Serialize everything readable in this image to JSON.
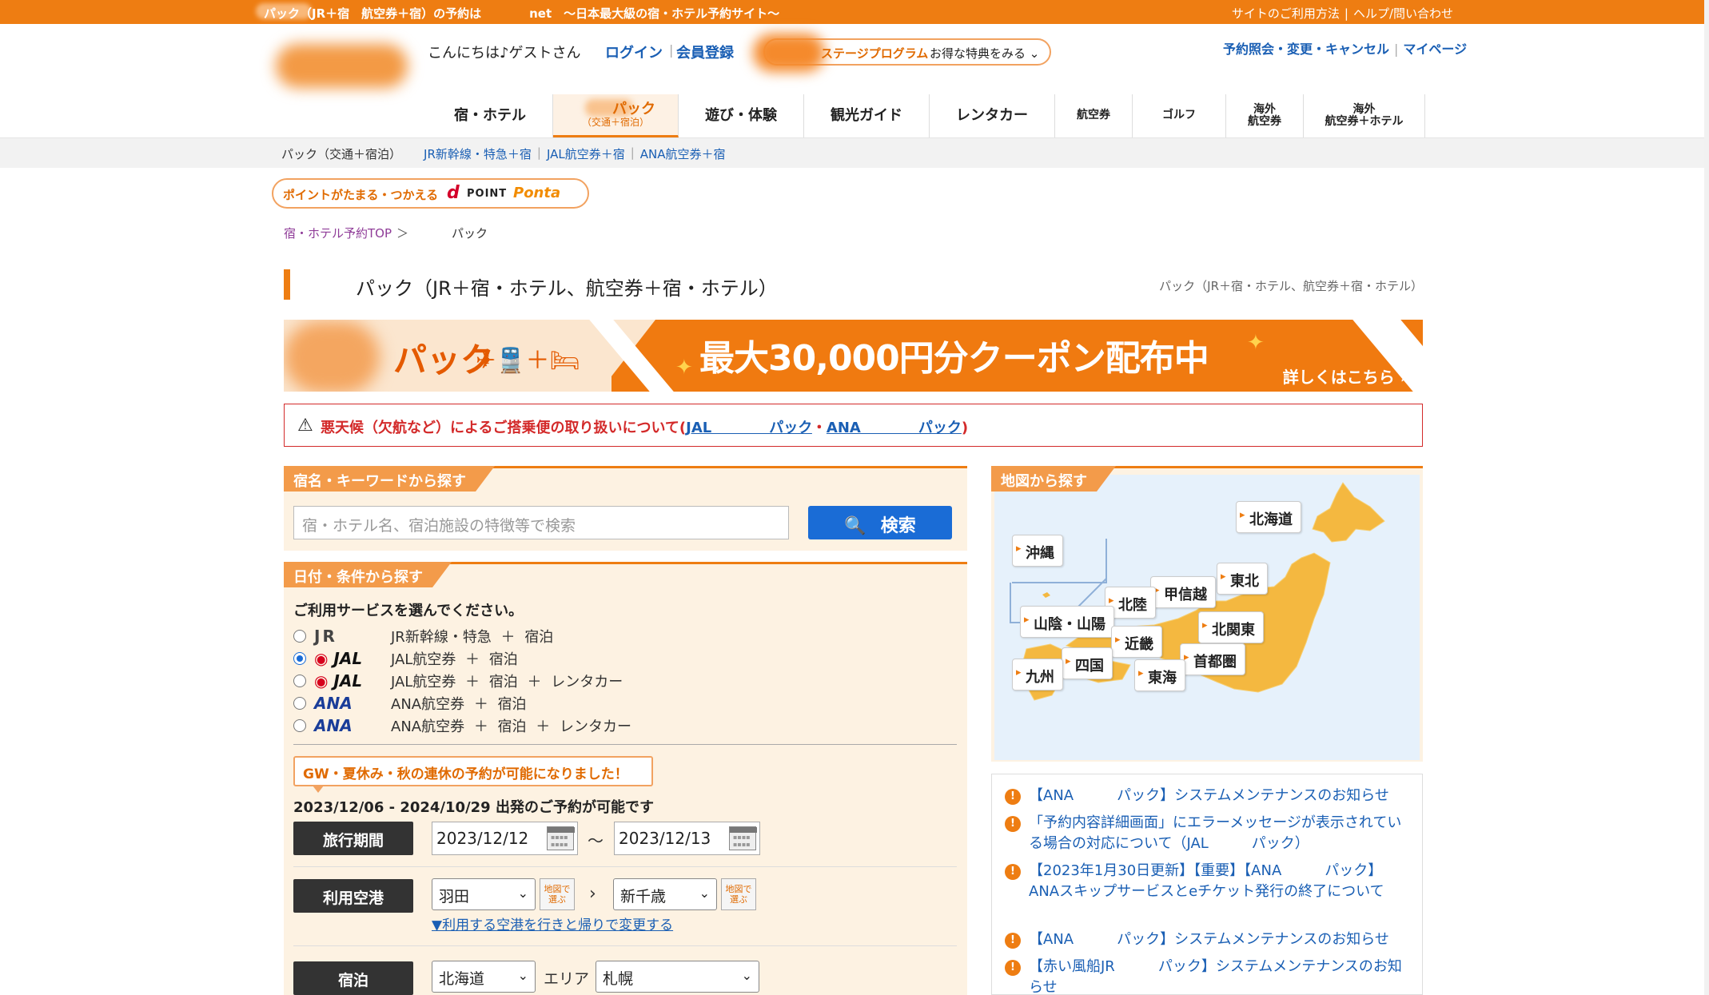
{
  "topbar": {
    "tagline": "パック（JR＋宿　航空券＋宿）の予約は　　　　net　〜日本最大級の宿・ホテル予約サイト〜",
    "links": [
      "サイトのご利用方法",
      "ヘルプ/問い合わせ"
    ]
  },
  "header": {
    "greeting": "こんにちは♪ゲストさん",
    "login": "ログイン",
    "register": "会員登録",
    "stage_program": "ステージプログラム",
    "stage_benefit": "お得な特典をみる",
    "my_links": [
      "予約照会・変更・キャンセル",
      "マイページ"
    ]
  },
  "nav": {
    "items": [
      {
        "label": "宿・ホテル"
      },
      {
        "label": "パック",
        "sub": "（交通＋宿泊）"
      },
      {
        "label": "遊び・体験"
      },
      {
        "label": "観光ガイド"
      },
      {
        "label": "レンタカー"
      },
      {
        "label": "航空券"
      },
      {
        "label": "ゴルフ"
      },
      {
        "label": "海外\n航空券"
      },
      {
        "label": "海外\n航空券＋ホテル"
      }
    ]
  },
  "subnav": {
    "current": "パック（交通＋宿泊）",
    "links": [
      "JR新幹線・特急＋宿",
      "JAL航空券＋宿",
      "ANA航空券＋宿"
    ]
  },
  "points": {
    "text": "ポイントがたまる・つかえる",
    "dpoint": "POINT",
    "ponta": "Ponta"
  },
  "breadcrumb": {
    "home": "宿・ホテル予約TOP",
    "current": "パック"
  },
  "page": {
    "title": "パック（JR＋宿・ホテル、航空券＋宿・ホテル）",
    "subtitle": "パック（JR＋宿・ホテル、航空券＋宿・ホテル）"
  },
  "promo": {
    "pack": "パック",
    "icons": "✈🚆＋🛏",
    "headline": "最大30,000円分クーポン配布中",
    "more": "詳しくはこちら ›"
  },
  "alert": {
    "text": "悪天候（欠航など）によるご搭乗便の取り扱いについて(",
    "link_jal": "JAL　　　　パック",
    "mid": "・",
    "link_ana": "ANA　　　　パック",
    "end": ")"
  },
  "keyword": {
    "tab": "宿名・キーワードから探す",
    "placeholder": "宿・ホテル名、宿泊施設の特徴等で検索",
    "button": "検索"
  },
  "conditions": {
    "tab": "日付・条件から探す",
    "question": "ご利用サービスを選んでください。",
    "services": [
      {
        "logo": "JR",
        "desc": "JR新幹線・特急 ＋ 宿泊",
        "selected": false
      },
      {
        "logo": "JAL",
        "desc": "JAL航空券 ＋ 宿泊",
        "selected": true
      },
      {
        "logo": "JAL",
        "desc": "JAL航空券 ＋ 宿泊 ＋ レンタカー",
        "selected": false
      },
      {
        "logo": "ANA",
        "desc": "ANA航空券 ＋ 宿泊",
        "selected": false
      },
      {
        "logo": "ANA",
        "desc": "ANA航空券 ＋ 宿泊 ＋ レンタカー",
        "selected": false
      }
    ],
    "notice": "GW・夏休み・秋の連休の予約が可能になりました！",
    "range": "2023/12/06 - 2024/10/29 出発のご予約が可能です",
    "period_label": "旅行期間",
    "date_from": "2023/12/12",
    "date_to": "2023/12/13",
    "tilde": "〜",
    "airport_label": "利用空港",
    "airport_from": "羽田",
    "airport_to": "新千歳",
    "map_pick": "地図で\n選ぶ",
    "change_airport": "▼利用する空港を行きと帰りで変更する",
    "stay_label": "宿泊",
    "pref": "北海道",
    "area_label": "エリア",
    "area": "札幌"
  },
  "map": {
    "tab": "地図から探す",
    "regions": [
      "北海道",
      "沖縄",
      "東北",
      "甲信越",
      "北陸",
      "山陰・山陽",
      "北関東",
      "近畿",
      "四国",
      "首都圏",
      "九州",
      "東海"
    ]
  },
  "news": [
    {
      "text": "【ANA　　　パック】システムメンテナンスのお知らせ"
    },
    {
      "text": "「予約内容詳細画面」にエラーメッセージが表示されている場合の対応について（JAL　　　パック）"
    },
    {
      "text": "【2023年1月30日更新】【重要】【ANA　　　パック】ANAスキップサービスとeチケット発行の終了について"
    },
    {
      "text": "【ANA　　　パック】システムメンテナンスのお知らせ"
    },
    {
      "text": "【赤い風船JR　　　パック】システムメンテナンスのお知らせ"
    }
  ],
  "colors": {
    "brand_orange": "#ee7d12",
    "link_blue": "#1a5fb4",
    "alert_red": "#d32a2a",
    "search_blue": "#1a6cd6"
  }
}
